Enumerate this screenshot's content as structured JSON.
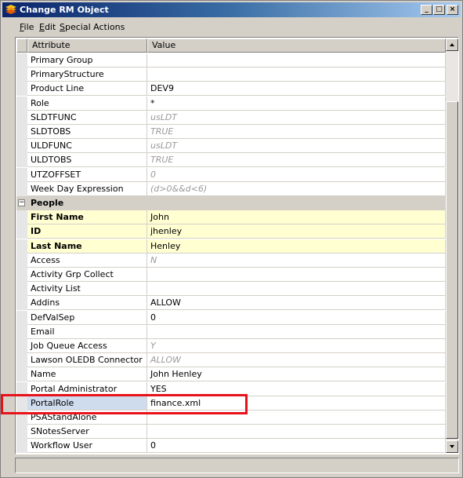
{
  "window": {
    "title": "Change RM Object",
    "buttons": {
      "minimize": "_",
      "maximize": "□",
      "close": "×"
    }
  },
  "menu": [
    {
      "label": "File",
      "mnemonic": "F",
      "rest": "ile"
    },
    {
      "label": "Edit",
      "mnemonic": "E",
      "rest": "dit"
    },
    {
      "label": "Special Actions",
      "mnemonic": "S",
      "rest": "pecial Actions"
    }
  ],
  "grid": {
    "headers": {
      "attribute": "Attribute",
      "value": "Value"
    },
    "rows": [
      {
        "attribute": "Primary Group",
        "value": ""
      },
      {
        "attribute": "PrimaryStructure",
        "value": ""
      },
      {
        "attribute": "Product Line",
        "value": "DEV9"
      },
      {
        "attribute": "Role",
        "value": "*"
      },
      {
        "attribute": "SLDTFUNC",
        "value": "usLDT",
        "is_default": true
      },
      {
        "attribute": "SLDTOBS",
        "value": "TRUE",
        "is_default": true
      },
      {
        "attribute": "ULDFUNC",
        "value": "usLDT",
        "is_default": true
      },
      {
        "attribute": "ULDTOBS",
        "value": "TRUE",
        "is_default": true
      },
      {
        "attribute": "UTZOFFSET",
        "value": "0",
        "is_default": true
      },
      {
        "attribute": "Week Day Expression",
        "value": "(d>0&&d<6)",
        "is_default": true
      },
      {
        "category": "People",
        "collapse_glyph": "−"
      },
      {
        "attribute": "First Name",
        "value": "John",
        "required": true
      },
      {
        "attribute": "ID",
        "value": "jhenley",
        "required": true
      },
      {
        "attribute": "Last Name",
        "value": "Henley",
        "required": true
      },
      {
        "attribute": "Access",
        "value": "N",
        "is_default": true
      },
      {
        "attribute": "Activity Grp Collect",
        "value": ""
      },
      {
        "attribute": "Activity List",
        "value": ""
      },
      {
        "attribute": "Addins",
        "value": "ALLOW"
      },
      {
        "attribute": "DefValSep",
        "value": "0"
      },
      {
        "attribute": "Email",
        "value": ""
      },
      {
        "attribute": "Job Queue Access",
        "value": "Y",
        "is_default": true
      },
      {
        "attribute": "Lawson OLEDB Connector",
        "value": "ALLOW",
        "is_default": true
      },
      {
        "attribute": "Name",
        "value": "John Henley"
      },
      {
        "attribute": "Portal Administrator",
        "value": "YES"
      },
      {
        "attribute": "PortalRole",
        "value": "finance.xml",
        "selected": true
      },
      {
        "attribute": "PSAStandAlone",
        "value": ""
      },
      {
        "attribute": "SNotesServer",
        "value": ""
      },
      {
        "attribute": "Workflow User",
        "value": "0"
      }
    ]
  },
  "colors": {
    "required_row": "#ffffd2",
    "default_value_text": "#9a9a9a",
    "highlight_annotation": "#e8121b",
    "titlebar_start": "#0a246a",
    "titlebar_end": "#a6caf0"
  },
  "icons": {
    "app": "lawson-logo-icon",
    "collapse": "collapse-minus-icon",
    "scroll_up": "arrow-up-icon",
    "scroll_down": "arrow-down-icon"
  }
}
